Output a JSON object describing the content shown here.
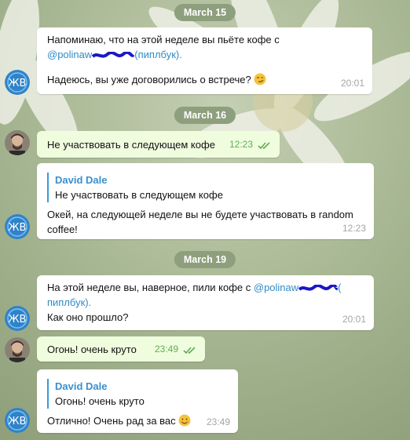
{
  "colors": {
    "bg": "#9aab85",
    "date_pill": "#8e9f7d",
    "incoming_bubble": "#ffffff",
    "outgoing_bubble": "#effdde",
    "link": "#2f8cc6",
    "outgoing_time": "#62ac55"
  },
  "dates": [
    "March 15",
    "March 16",
    "March 19"
  ],
  "messages": [
    {
      "line1": "Напоминаю, что на этой неделе вы пьёте кофе с",
      "mention_prefix": "@polinaw",
      "mention_suffix": "(пиплбук).",
      "line3": "Надеюсь, вы уже договорились о встрече?",
      "emoji": "smirk-emoji",
      "time": "20:01"
    },
    {
      "text": "Не участвовать в следующем кофе",
      "time": "12:23"
    },
    {
      "quote_name": "David Dale",
      "quote_text": "Не участвовать в следующем кофе",
      "line1": "Окей, на следующей неделе вы не будете участвовать в random",
      "line2": "coffee!",
      "time": "12:23"
    },
    {
      "line1_prefix": "На этой неделе вы, наверное, пили кофе с ",
      "mention_prefix": "@polinaw",
      "mention_suffix": "(",
      "line2": "пиплбук).",
      "line2_suffix": "",
      "line3": "Как оно прошло?",
      "time": "20:01"
    },
    {
      "text": "Огонь! очень круто",
      "time": "23:49"
    },
    {
      "quote_name": "David Dale",
      "quote_text": "Огонь! очень круто",
      "line1": "Отлично! Очень рад за вас",
      "emoji": "smile-emoji",
      "time": "23:49"
    }
  ]
}
